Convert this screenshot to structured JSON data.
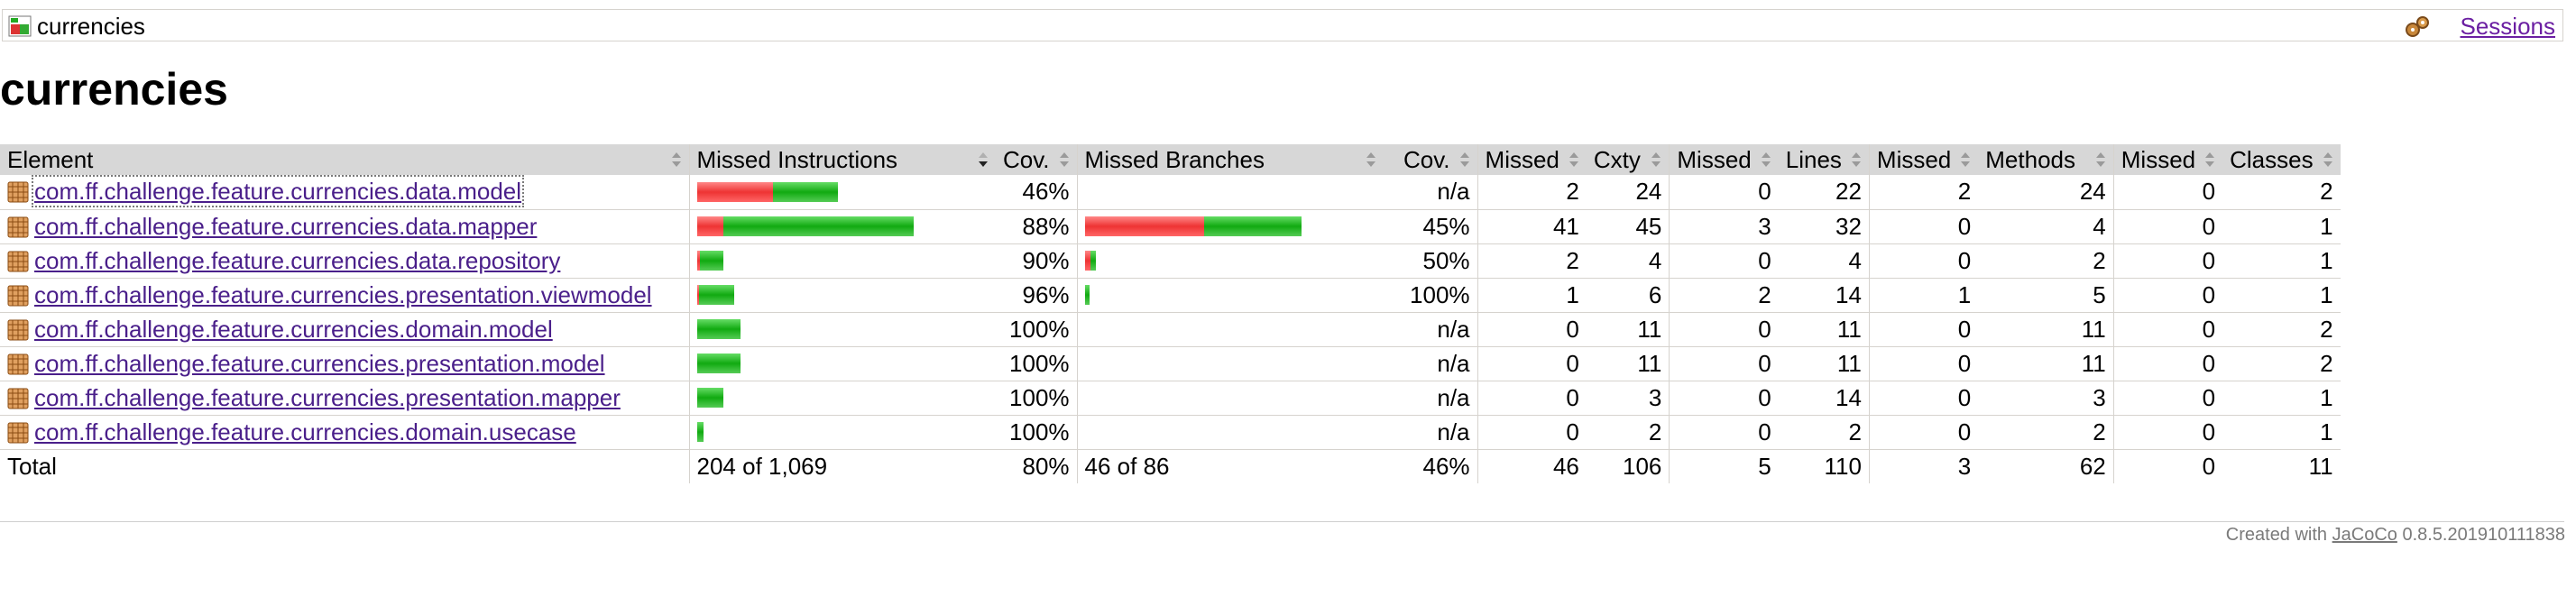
{
  "breadcrumb": {
    "title": "currencies",
    "sessions_label": "Sessions"
  },
  "page_title": "currencies",
  "table": {
    "headers": {
      "element": "Element",
      "missed_instructions": "Missed Instructions",
      "cov1": "Cov.",
      "missed_branches": "Missed Branches",
      "cov2": "Cov.",
      "missed_cxty": "Missed",
      "cxty": "Cxty",
      "missed_lines": "Missed",
      "lines": "Lines",
      "missed_methods": "Missed",
      "methods": "Methods",
      "missed_classes": "Missed",
      "classes": "Classes"
    },
    "rows": [
      {
        "name": "com.ff.challenge.feature.currencies.data.model",
        "instr_missed_frac": 0.54,
        "instr_total_frac": 0.65,
        "instr_cov": "46%",
        "br_missed_frac": 0,
        "br_total_frac": 0,
        "br_cov": "n/a",
        "missed_cxty": "2",
        "cxty": "24",
        "missed_lines": "0",
        "lines": "22",
        "missed_methods": "2",
        "methods": "24",
        "missed_classes": "0",
        "classes": "2"
      },
      {
        "name": "com.ff.challenge.feature.currencies.data.mapper",
        "instr_missed_frac": 0.12,
        "instr_total_frac": 1.0,
        "instr_cov": "88%",
        "br_missed_frac": 0.55,
        "br_total_frac": 1.0,
        "br_cov": "45%",
        "missed_cxty": "41",
        "cxty": "45",
        "missed_lines": "3",
        "lines": "32",
        "missed_methods": "0",
        "methods": "4",
        "missed_classes": "0",
        "classes": "1"
      },
      {
        "name": "com.ff.challenge.feature.currencies.data.repository",
        "instr_missed_frac": 0.1,
        "instr_total_frac": 0.12,
        "instr_cov": "90%",
        "br_missed_frac": 0.5,
        "br_total_frac": 0.05,
        "br_cov": "50%",
        "missed_cxty": "2",
        "cxty": "4",
        "missed_lines": "0",
        "lines": "4",
        "missed_methods": "0",
        "methods": "2",
        "missed_classes": "0",
        "classes": "1"
      },
      {
        "name": "com.ff.challenge.feature.currencies.presentation.viewmodel",
        "instr_missed_frac": 0.04,
        "instr_total_frac": 0.17,
        "instr_cov": "96%",
        "br_missed_frac": 0,
        "br_total_frac": 0.02,
        "br_cov": "100%",
        "missed_cxty": "1",
        "cxty": "6",
        "missed_lines": "2",
        "lines": "14",
        "missed_methods": "1",
        "methods": "5",
        "missed_classes": "0",
        "classes": "1"
      },
      {
        "name": "com.ff.challenge.feature.currencies.domain.model",
        "instr_missed_frac": 0,
        "instr_total_frac": 0.2,
        "instr_cov": "100%",
        "br_missed_frac": 0,
        "br_total_frac": 0,
        "br_cov": "n/a",
        "missed_cxty": "0",
        "cxty": "11",
        "missed_lines": "0",
        "lines": "11",
        "missed_methods": "0",
        "methods": "11",
        "missed_classes": "0",
        "classes": "2"
      },
      {
        "name": "com.ff.challenge.feature.currencies.presentation.model",
        "instr_missed_frac": 0,
        "instr_total_frac": 0.2,
        "instr_cov": "100%",
        "br_missed_frac": 0,
        "br_total_frac": 0,
        "br_cov": "n/a",
        "missed_cxty": "0",
        "cxty": "11",
        "missed_lines": "0",
        "lines": "11",
        "missed_methods": "0",
        "methods": "11",
        "missed_classes": "0",
        "classes": "2"
      },
      {
        "name": "com.ff.challenge.feature.currencies.presentation.mapper",
        "instr_missed_frac": 0,
        "instr_total_frac": 0.12,
        "instr_cov": "100%",
        "br_missed_frac": 0,
        "br_total_frac": 0,
        "br_cov": "n/a",
        "missed_cxty": "0",
        "cxty": "3",
        "missed_lines": "0",
        "lines": "14",
        "missed_methods": "0",
        "methods": "3",
        "missed_classes": "0",
        "classes": "1"
      },
      {
        "name": "com.ff.challenge.feature.currencies.domain.usecase",
        "instr_missed_frac": 0,
        "instr_total_frac": 0.03,
        "instr_cov": "100%",
        "br_missed_frac": 0,
        "br_total_frac": 0,
        "br_cov": "n/a",
        "missed_cxty": "0",
        "cxty": "2",
        "missed_lines": "0",
        "lines": "2",
        "missed_methods": "0",
        "methods": "2",
        "missed_classes": "0",
        "classes": "1"
      }
    ],
    "total": {
      "label": "Total",
      "instructions": "204 of 1,069",
      "instr_cov": "80%",
      "branches": "46 of 86",
      "br_cov": "46%",
      "missed_cxty": "46",
      "cxty": "106",
      "missed_lines": "5",
      "lines": "110",
      "missed_methods": "3",
      "methods": "62",
      "missed_classes": "0",
      "classes": "11"
    }
  },
  "footer": {
    "prefix": "Created with",
    "tool": "JaCoCo",
    "version": "0.8.5.201910111838"
  },
  "colors": {
    "missed": "#e33333",
    "covered": "#1aaa1a",
    "header_bg": "#d7d7d7",
    "link": "#4a1f8a"
  }
}
